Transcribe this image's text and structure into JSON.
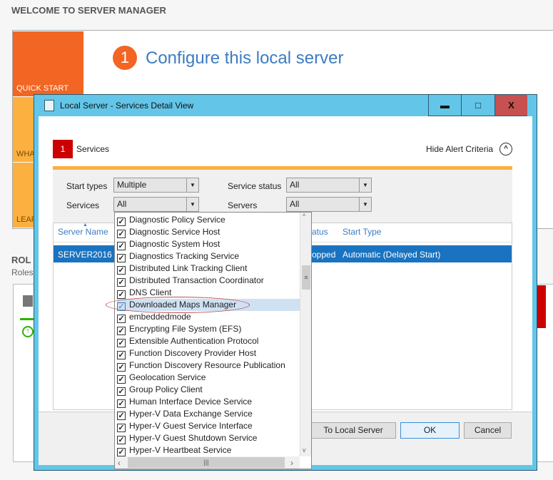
{
  "background": {
    "title": "WELCOME TO SERVER MANAGER",
    "tiles": [
      "QUICK START",
      "WHA",
      "LEAR"
    ],
    "step_number": "1",
    "step_title": "Configure this local server",
    "roles_heading": "ROL",
    "roles_sub": "Roles:"
  },
  "dialog": {
    "title": "Local Server - Services Detail View",
    "alert_count": "1",
    "alert_label": "Services",
    "hide_alert_criteria": "Hide Alert Criteria",
    "filters": {
      "start_types_label": "Start types",
      "start_types_value": "Multiple",
      "service_status_label": "Service status",
      "service_status_value": "All",
      "services_label": "Services",
      "services_value": "All",
      "servers_label": "Servers",
      "servers_value": "All"
    },
    "columns": [
      "Server Name",
      "atus",
      "Start Type"
    ],
    "row": {
      "server": "SERVER2016",
      "status": "opped",
      "start_type": "Automatic (Delayed Start)"
    },
    "buttons": {
      "go_to": "To Local Server",
      "ok": "OK",
      "cancel": "Cancel"
    }
  },
  "services_dropdown": {
    "items": [
      {
        "label": "Diagnostic Policy Service",
        "checked": true
      },
      {
        "label": "Diagnostic Service Host",
        "checked": true
      },
      {
        "label": "Diagnostic System Host",
        "checked": true
      },
      {
        "label": "Diagnostics Tracking Service",
        "checked": true
      },
      {
        "label": "Distributed Link Tracking Client",
        "checked": true
      },
      {
        "label": "Distributed Transaction Coordinator",
        "checked": true
      },
      {
        "label": "DNS Client",
        "checked": true
      },
      {
        "label": "Downloaded Maps Manager",
        "checked": true
      },
      {
        "label": "embeddedmode",
        "checked": true
      },
      {
        "label": "Encrypting File System (EFS)",
        "checked": true
      },
      {
        "label": "Extensible Authentication Protocol",
        "checked": true
      },
      {
        "label": "Function Discovery Provider Host",
        "checked": true
      },
      {
        "label": "Function Discovery Resource Publication",
        "checked": true
      },
      {
        "label": "Geolocation Service",
        "checked": true
      },
      {
        "label": "Group Policy Client",
        "checked": true
      },
      {
        "label": "Human Interface Device Service",
        "checked": true
      },
      {
        "label": "Hyper-V Data Exchange Service",
        "checked": true
      },
      {
        "label": "Hyper-V Guest Service Interface",
        "checked": true
      },
      {
        "label": "Hyper-V Guest Shutdown Service",
        "checked": true
      },
      {
        "label": "Hyper-V Heartbeat Service",
        "checked": true
      }
    ],
    "highlighted": "Downloaded Maps Manager"
  }
}
